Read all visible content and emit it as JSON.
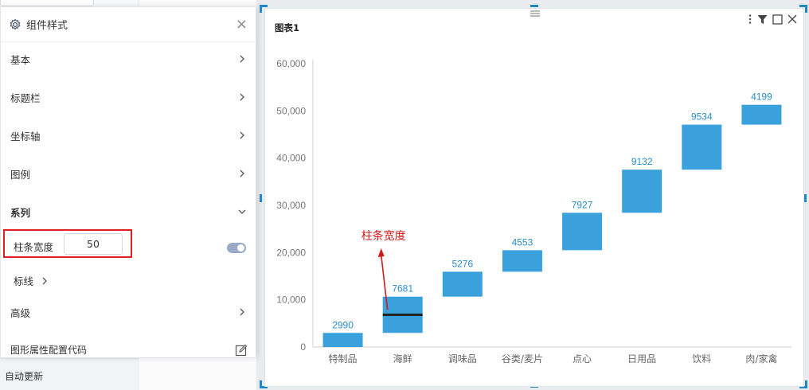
{
  "panel": {
    "title": "组件样式",
    "close": "×",
    "items": [
      {
        "label": "基本"
      },
      {
        "label": "标题栏"
      },
      {
        "label": "坐标轴"
      },
      {
        "label": "图例"
      },
      {
        "label": "系列"
      }
    ],
    "bar_width": {
      "label": "柱条宽度",
      "value": "50"
    },
    "markline": {
      "label": "标线"
    },
    "advanced": {
      "label": "高级"
    },
    "code": {
      "label": "图形属性配置代码"
    }
  },
  "sidebar": {
    "auto_update": "自动更新"
  },
  "chart_card": {
    "title": "图表1"
  },
  "colors": {
    "bar": "#3ba1dc",
    "label": "#2a8dc8",
    "annotation": "#d11a1a",
    "accent": "#1e88c9"
  },
  "chart_data": {
    "type": "bar",
    "subtype": "waterfall",
    "title": "图表1",
    "categories": [
      "特制品",
      "海鲜",
      "调味品",
      "谷类/麦片",
      "点心",
      "日用品",
      "饮料",
      "肉/家禽"
    ],
    "values": [
      2990,
      7681,
      5276,
      4553,
      7927,
      9132,
      9534,
      4199
    ],
    "ylim": [
      0,
      60000
    ],
    "yticks": [
      0,
      10000,
      20000,
      30000,
      40000,
      50000,
      60000
    ],
    "ytick_labels": [
      "0",
      "10,000",
      "20,000",
      "30,000",
      "40,000",
      "50,000",
      "60,000"
    ],
    "grid": false,
    "legend": "none",
    "annotation": {
      "text": "柱条宽度",
      "target_category": "海鲜"
    }
  }
}
